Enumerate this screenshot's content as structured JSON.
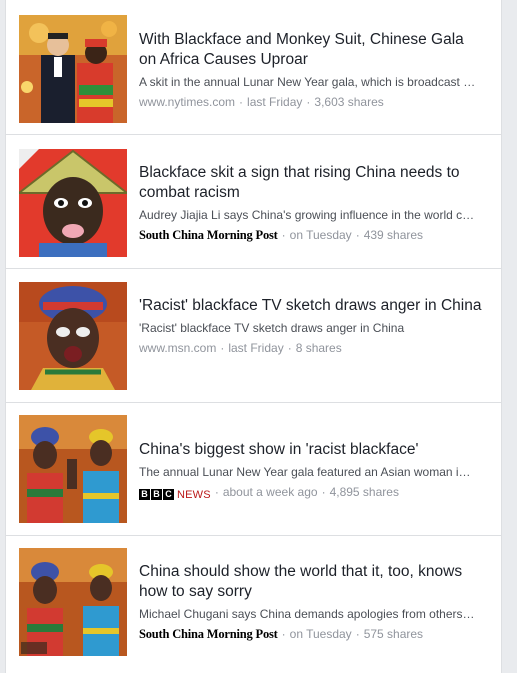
{
  "articles": [
    {
      "title": "With Blackface and Monkey Suit, Chinese Gala on Africa Causes Uproar",
      "summary": "A skit in the annual Lunar New Year gala, which is broadcast …",
      "source": "www.nytimes.com",
      "time": "last Friday",
      "shares": "3,603 shares"
    },
    {
      "title": "Blackface skit a sign that rising China needs to combat racism",
      "summary": "Audrey Jiajia Li says China's growing influence in the world c…",
      "source": "South China Morning Post",
      "time": "on Tuesday",
      "shares": "439 shares"
    },
    {
      "title": "'Racist' blackface TV sketch draws anger in China",
      "summary": "'Racist' blackface TV sketch draws anger in China",
      "source": "www.msn.com",
      "time": "last Friday",
      "shares": "8 shares"
    },
    {
      "title": "China's biggest show in 'racist blackface'",
      "summary": "The annual Lunar New Year gala featured an Asian woman i…",
      "source_logo": {
        "box1": "B",
        "box2": "B",
        "box3": "C",
        "word": "NEWS"
      },
      "time": "about a week ago",
      "shares": "4,895 shares"
    },
    {
      "title": "China should show the world that it, too, knows how to say sorry",
      "summary": "Michael Chugani says China demands apologies from others…",
      "source": "South China Morning Post",
      "time": "on Tuesday",
      "shares": "575 shares"
    }
  ],
  "colors": {
    "title": "#1d2129",
    "summary": "#4b4f56",
    "meta": "#90949c",
    "divider": "#dddfe2",
    "bbc_red": "#bb1919"
  }
}
